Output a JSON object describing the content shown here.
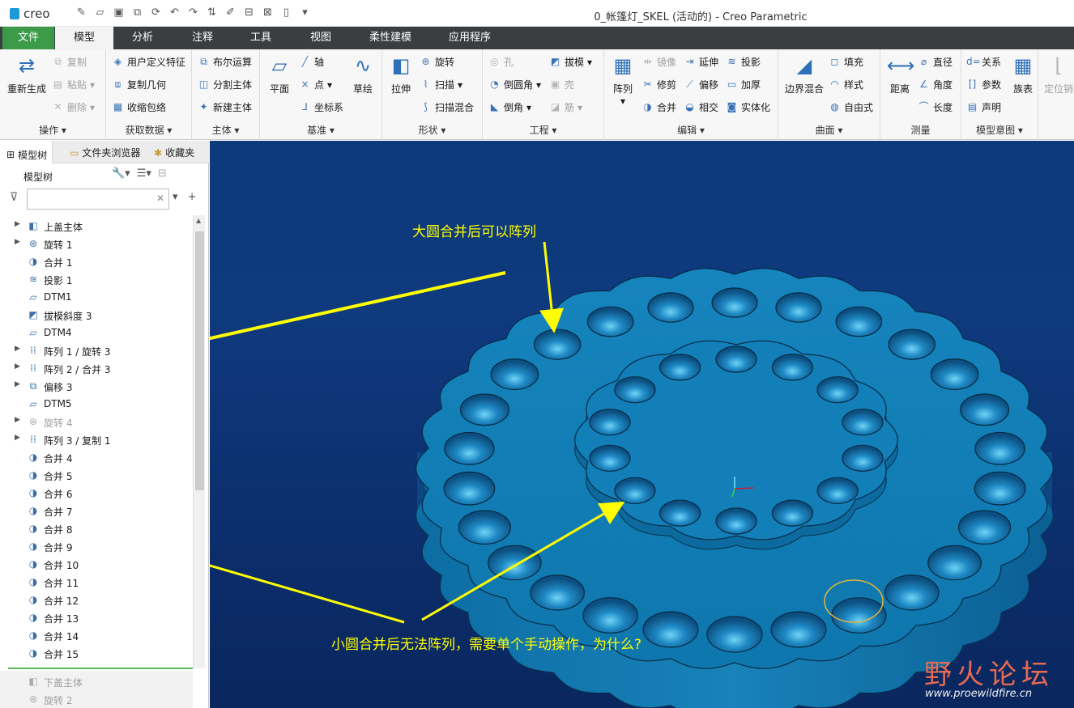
{
  "app": {
    "logo": "creo",
    "window_title": "0_帐篷灯_SKEL (活动的) - Creo Parametric"
  },
  "menubar": {
    "tabs": [
      "文件",
      "模型",
      "分析",
      "注释",
      "工具",
      "视图",
      "柔性建模",
      "应用程序"
    ],
    "active": "模型"
  },
  "ribbon": {
    "operations": {
      "regen": "重新生成",
      "copy": "复制",
      "paste": "粘贴",
      "delete": "删除",
      "label": "操作"
    },
    "getdata": {
      "udf": "用户定义特征",
      "copygeom": "复制几何",
      "shrinkwrap": "收缩包络",
      "label": "获取数据"
    },
    "body": {
      "boolean": "布尔运算",
      "split": "分割主体",
      "newbody": "新建主体",
      "label": "主体"
    },
    "datum": {
      "plane": "平面",
      "axis": "轴",
      "point": "点",
      "csys": "坐标系",
      "sketch": "草绘",
      "label": "基准"
    },
    "shapes": {
      "extrude": "拉伸",
      "revolve": "旋转",
      "sweep": "扫描",
      "sweptblend": "扫描混合",
      "label": "形状"
    },
    "engineering": {
      "hole": "孔",
      "round": "倒圆角",
      "chamfer": "倒角",
      "draft": "拔模",
      "shell": "壳",
      "rib": "筋",
      "label": "工程"
    },
    "editing": {
      "pattern": "阵列",
      "mirror": "镜像",
      "extend": "延伸",
      "project": "投影",
      "trim": "修剪",
      "offset": "偏移",
      "thicken": "加厚",
      "merge": "合并",
      "intersect": "相交",
      "solidify": "实体化",
      "label": "编辑"
    },
    "surfaces": {
      "boundaryblend": "边界混合",
      "fill": "填充",
      "style": "样式",
      "freestyle": "自由式",
      "label": "曲面"
    },
    "measure": {
      "distance": "距离",
      "diameter": "直径",
      "angle": "角度",
      "length": "长度",
      "label": "测量"
    },
    "modelintent": {
      "relations": "关系",
      "params": "参数",
      "declare": "声明",
      "familytable": "族表",
      "label": "模型意图"
    },
    "extra": {
      "locate": "定位销"
    }
  },
  "leftpanel": {
    "tabs": [
      "模型树",
      "文件夹浏览器",
      "收藏夹"
    ],
    "tree_heading": "模型树",
    "search_placeholder": "",
    "items": [
      {
        "label": "上盖主体",
        "icon": "body-icon",
        "expand": true
      },
      {
        "label": "旋转 1",
        "icon": "revolve-icon",
        "expand": true
      },
      {
        "label": "合并 1",
        "icon": "merge-icon",
        "expand": false
      },
      {
        "label": "投影 1",
        "icon": "project-icon",
        "expand": false
      },
      {
        "label": "DTM1",
        "icon": "datum-plane-icon",
        "expand": false
      },
      {
        "label": "拔模斜度 3",
        "icon": "draft-icon",
        "expand": false
      },
      {
        "label": "DTM4",
        "icon": "datum-plane-icon",
        "expand": false
      },
      {
        "label": "阵列 1 / 旋转 3",
        "icon": "pattern-icon",
        "expand": true
      },
      {
        "label": "阵列 2 / 合并 3",
        "icon": "pattern-icon",
        "expand": true
      },
      {
        "label": "偏移 3",
        "icon": "offset-icon",
        "expand": true
      },
      {
        "label": "DTM5",
        "icon": "datum-plane-icon",
        "expand": false
      },
      {
        "label": "旋转 4",
        "icon": "revolve-icon",
        "expand": true,
        "dim": true
      },
      {
        "label": "阵列 3 / 复制 1",
        "icon": "pattern-icon",
        "expand": true
      },
      {
        "label": "合并 4",
        "icon": "merge-icon",
        "expand": false
      },
      {
        "label": "合并 5",
        "icon": "merge-icon",
        "expand": false
      },
      {
        "label": "合并 6",
        "icon": "merge-icon",
        "expand": false
      },
      {
        "label": "合并 7",
        "icon": "merge-icon",
        "expand": false
      },
      {
        "label": "合并 8",
        "icon": "merge-icon",
        "expand": false
      },
      {
        "label": "合并 9",
        "icon": "merge-icon",
        "expand": false
      },
      {
        "label": "合并 10",
        "icon": "merge-icon",
        "expand": false
      },
      {
        "label": "合并 11",
        "icon": "merge-icon",
        "expand": false
      },
      {
        "label": "合并 12",
        "icon": "merge-icon",
        "expand": false
      },
      {
        "label": "合并 13",
        "icon": "merge-icon",
        "expand": false
      },
      {
        "label": "合并 14",
        "icon": "merge-icon",
        "expand": false
      },
      {
        "label": "合并 15",
        "icon": "merge-icon",
        "expand": false
      }
    ],
    "lower_items": [
      {
        "label": "下盖主体",
        "icon": "body-icon"
      },
      {
        "label": "旋转 2",
        "icon": "revolve-icon"
      }
    ]
  },
  "viewport": {
    "annotation_top": "大圆合并后可以阵列",
    "annotation_bottom": "小圆合并后无法阵列，需要单个手动操作，为什么?",
    "watermark": "野火论坛",
    "watermark_url": "www.proewildfire.cn"
  },
  "colors": {
    "menubar": "#3b3e40",
    "file_tab": "#3b9b48",
    "viewport_bg": "#0f3a7e",
    "model": "#1a7fb8",
    "annotation": "#ffff00",
    "tree_divider": "#5cb85c"
  }
}
